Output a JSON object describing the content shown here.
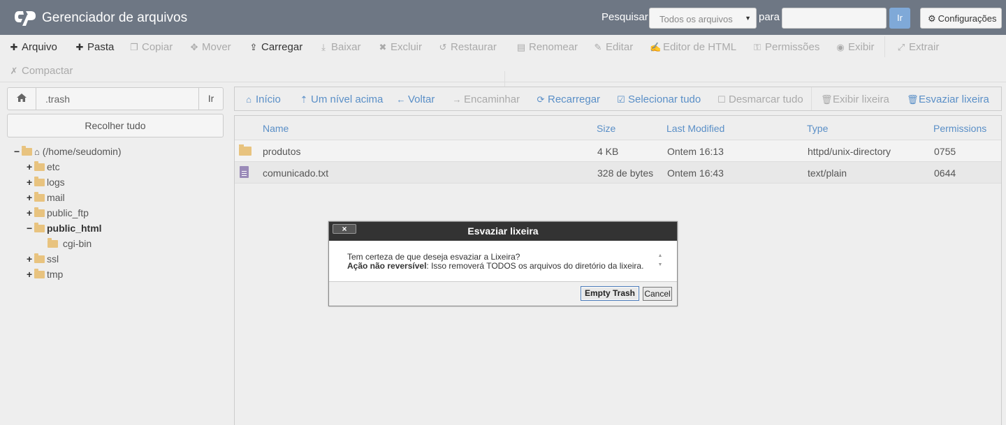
{
  "header": {
    "title": "Gerenciador de arquivos",
    "search_label": "Pesquisar",
    "search_scope": "Todos os arquivos",
    "para_label": "para",
    "search_value": "",
    "go_label": "Ir",
    "settings_label": "Configurações",
    "bar_color": "#6e7784"
  },
  "toolbar": {
    "row1": [
      {
        "label": "Arquivo",
        "icon": "plus-icon",
        "enabled": true
      },
      {
        "label": "Pasta",
        "icon": "plus-icon",
        "enabled": true
      },
      {
        "label": "Copiar",
        "icon": "copy-icon",
        "enabled": false
      },
      {
        "label": "Mover",
        "icon": "move-icon",
        "enabled": false
      },
      {
        "label": "Carregar",
        "icon": "upload-icon",
        "enabled": true
      },
      {
        "label": "Baixar",
        "icon": "download-icon",
        "enabled": false
      },
      {
        "label": "Excluir",
        "icon": "close-icon",
        "enabled": false
      },
      {
        "label": "Restaurar",
        "icon": "undo-icon",
        "enabled": false
      },
      {
        "label": "Renomear",
        "icon": "file-icon",
        "enabled": false
      },
      {
        "label": "Editar",
        "icon": "pencil-icon",
        "enabled": false
      },
      {
        "label": "Editor de HTML",
        "icon": "edit-icon",
        "enabled": false
      },
      {
        "label": "Permissões",
        "icon": "key-icon",
        "enabled": false
      },
      {
        "label": "Exibir",
        "icon": "eye-icon",
        "enabled": false
      },
      {
        "label": "Extrair",
        "icon": "expand-icon",
        "enabled": false
      }
    ],
    "row2": [
      {
        "label": "Compactar",
        "icon": "compress-icon",
        "enabled": false
      }
    ]
  },
  "left": {
    "path_value": ".trash",
    "go_label": "Ir",
    "collapse_label": "Recolher tudo",
    "tree": [
      {
        "label": "(/home/seudomin)",
        "toggle": "−",
        "level": 0,
        "home": true,
        "bold": false
      },
      {
        "label": "etc",
        "toggle": "+",
        "level": 1,
        "bold": false
      },
      {
        "label": "logs",
        "toggle": "+",
        "level": 1,
        "bold": false
      },
      {
        "label": "mail",
        "toggle": "+",
        "level": 1,
        "bold": false
      },
      {
        "label": "public_ftp",
        "toggle": "+",
        "level": 1,
        "bold": false
      },
      {
        "label": "public_html",
        "toggle": "−",
        "level": 1,
        "bold": true
      },
      {
        "label": "cgi-bin",
        "toggle": "",
        "level": 2,
        "bold": false
      },
      {
        "label": "ssl",
        "toggle": "+",
        "level": 1,
        "bold": false
      },
      {
        "label": "tmp",
        "toggle": "+",
        "level": 1,
        "bold": false
      }
    ]
  },
  "nav": [
    {
      "label": "Início",
      "icon": "home-icon",
      "enabled": true
    },
    {
      "label": "Um nível acima",
      "icon": "level-up-icon",
      "enabled": true
    },
    {
      "label": "Voltar",
      "icon": "arrow-left-icon",
      "enabled": true
    },
    {
      "label": "Encaminhar",
      "icon": "arrow-right-icon",
      "enabled": false
    },
    {
      "label": "Recarregar",
      "icon": "refresh-icon",
      "enabled": true
    },
    {
      "label": "Selecionar tudo",
      "icon": "check-square-icon",
      "enabled": true
    },
    {
      "label": "Desmarcar tudo",
      "icon": "square-icon",
      "enabled": false
    },
    {
      "label": "Exibir lixeira",
      "icon": "trash-icon",
      "enabled": false
    },
    {
      "label": "Esvaziar lixeira",
      "icon": "trash-icon",
      "enabled": true
    }
  ],
  "files": {
    "columns": [
      "Name",
      "Size",
      "Last Modified",
      "Type",
      "Permissions"
    ],
    "rows": [
      {
        "icon": "folder-icon",
        "name": "produtos",
        "size": "4 KB",
        "modified": "Ontem 16:13",
        "type": "httpd/unix-directory",
        "perms": "0755"
      },
      {
        "icon": "text-file-icon",
        "name": "comunicado.txt",
        "size": "328 de bytes",
        "modified": "Ontem 16:43",
        "type": "text/plain",
        "perms": "0644"
      }
    ]
  },
  "dialog": {
    "title": "Esvaziar lixeira",
    "close_label": "×",
    "line1": "Tem certeza de que deseja esvaziar a Lixeira?",
    "line2_bold": "Ação não reversível",
    "line2_rest": ": Isso removerá TODOS os arquivos do diretório da lixeira.",
    "confirm_label": "Empty Trash",
    "cancel_label": "Cancel"
  },
  "colors": {
    "link": "#5a8fc7",
    "folder": "#e8c37f",
    "disabled": "#aaaaaa"
  }
}
